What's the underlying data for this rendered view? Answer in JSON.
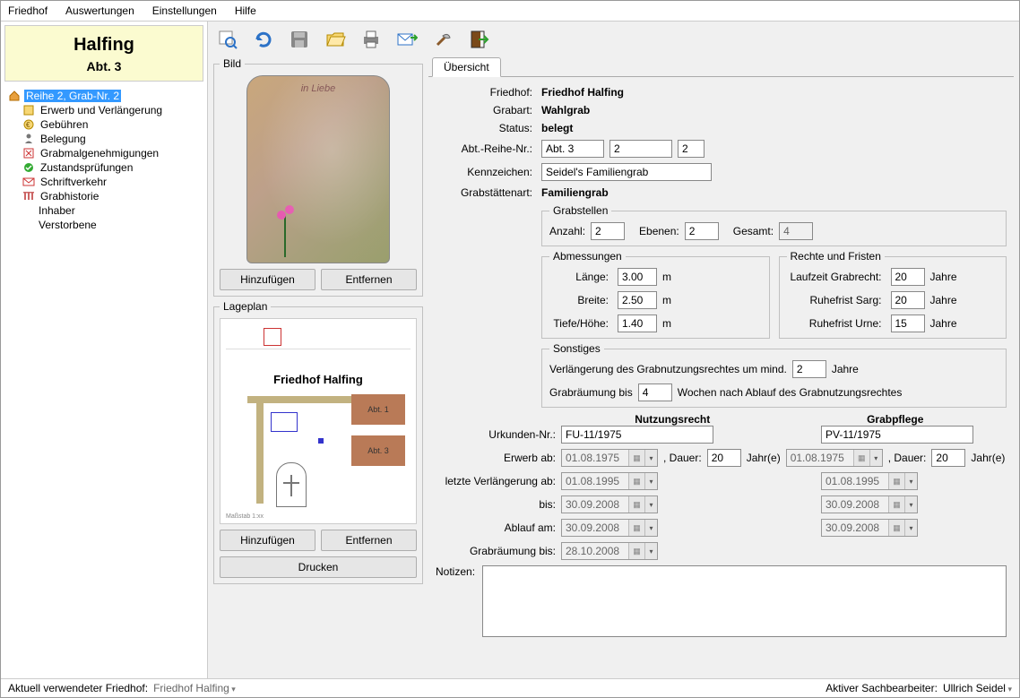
{
  "menu": {
    "friedhof": "Friedhof",
    "auswertungen": "Auswertungen",
    "einstellungen": "Einstellungen",
    "hilfe": "Hilfe"
  },
  "header": {
    "title": "Halfing",
    "sub": "Abt. 3"
  },
  "tree": {
    "root": "Reihe 2, Grab-Nr. 2",
    "erwerb": "Erwerb und Verlängerung",
    "gebuhren": "Gebühren",
    "belegung": "Belegung",
    "grabmal": "Grabmalgenehmigungen",
    "zustand": "Zustandsprüfungen",
    "schrift": "Schriftverkehr",
    "historie": "Grabhistorie",
    "inhaber": "Inhaber",
    "verstorbene": "Verstorbene"
  },
  "img": {
    "bild": "Bild",
    "inliebe": "in Liebe",
    "lageplan": "Lageplan",
    "planTitle": "Friedhof Halfing",
    "abt1": "Abt. 1",
    "abt3": "Abt. 3",
    "hinzufugen": "Hinzufügen",
    "entfernen": "Entfernen",
    "drucken": "Drucken"
  },
  "tab": {
    "ubersicht": "Übersicht"
  },
  "f": {
    "friedhof_l": "Friedhof:",
    "friedhof_v": "Friedhof Halfing",
    "grabart_l": "Grabart:",
    "grabart_v": "Wahlgrab",
    "status_l": "Status:",
    "status_v": "belegt",
    "abt_l": "Abt.-Reihe-Nr.:",
    "abt_v": "Abt. 3",
    "reihe_v": "2",
    "nr_v": "2",
    "kenn_l": "Kennzeichen:",
    "kenn_v": "Seidel's Familiengrab",
    "gart_l": "Grabstättenart:",
    "gart_v": "Familiengrab"
  },
  "gs": {
    "legend": "Grabstellen",
    "anzahl_l": "Anzahl:",
    "anzahl_v": "2",
    "ebenen_l": "Ebenen:",
    "ebenen_v": "2",
    "gesamt_l": "Gesamt:",
    "gesamt_v": "4"
  },
  "abm": {
    "legend": "Abmessungen",
    "lange_l": "Länge:",
    "lange_v": "3.00",
    "breite_l": "Breite:",
    "breite_v": "2.50",
    "tiefe_l": "Tiefe/Höhe:",
    "tiefe_v": "1.40",
    "m": "m"
  },
  "rf": {
    "legend": "Rechte und Fristen",
    "lauf_l": "Laufzeit Grabrecht:",
    "lauf_v": "20",
    "sarg_l": "Ruhefrist Sarg:",
    "sarg_v": "20",
    "urne_l": "Ruhefrist Urne:",
    "urne_v": "15",
    "jahre": "Jahre"
  },
  "so": {
    "legend": "Sonstiges",
    "verl1": "Verlängerung des Grabnutzungsrechtes um mind.",
    "verl_v": "2",
    "verl2": "Jahre",
    "raum1": "Grabräumung bis",
    "raum_v": "4",
    "raum2": "Wochen nach Ablauf des Grabnutzungsrechtes"
  },
  "rh": {
    "nutz": "Nutzungsrecht",
    "pflege": "Grabpflege"
  },
  "nr": {
    "urk_l": "Urkunden-Nr.:",
    "urk_n": "FU-11/1975",
    "urk_p": "PV-11/1975",
    "erw_l": "Erwerb ab:",
    "erw_n": "01.08.1975",
    "erw_p": "01.08.1975",
    "dauer_l": ", Dauer:",
    "dauer_n": "20",
    "dauer_p": "20",
    "jahre": "Jahr(e)",
    "lv_l": "letzte Verlängerung ab:",
    "lv_n": "01.08.1995",
    "lv_p": "01.08.1995",
    "bis_l": "bis:",
    "bis_n": "30.09.2008",
    "bis_p": "30.09.2008",
    "abl_l": "Ablauf am:",
    "abl_n": "30.09.2008",
    "abl_p": "30.09.2008",
    "gr_l": "Grabräumung bis:",
    "gr_n": "28.10.2008"
  },
  "notes_l": "Notizen:",
  "status": {
    "l1": "Aktuell verwendeter Friedhof:",
    "v1": "Friedhof Halfing",
    "l2": "Aktiver Sachbearbeiter:",
    "v2": "Ullrich Seidel"
  }
}
